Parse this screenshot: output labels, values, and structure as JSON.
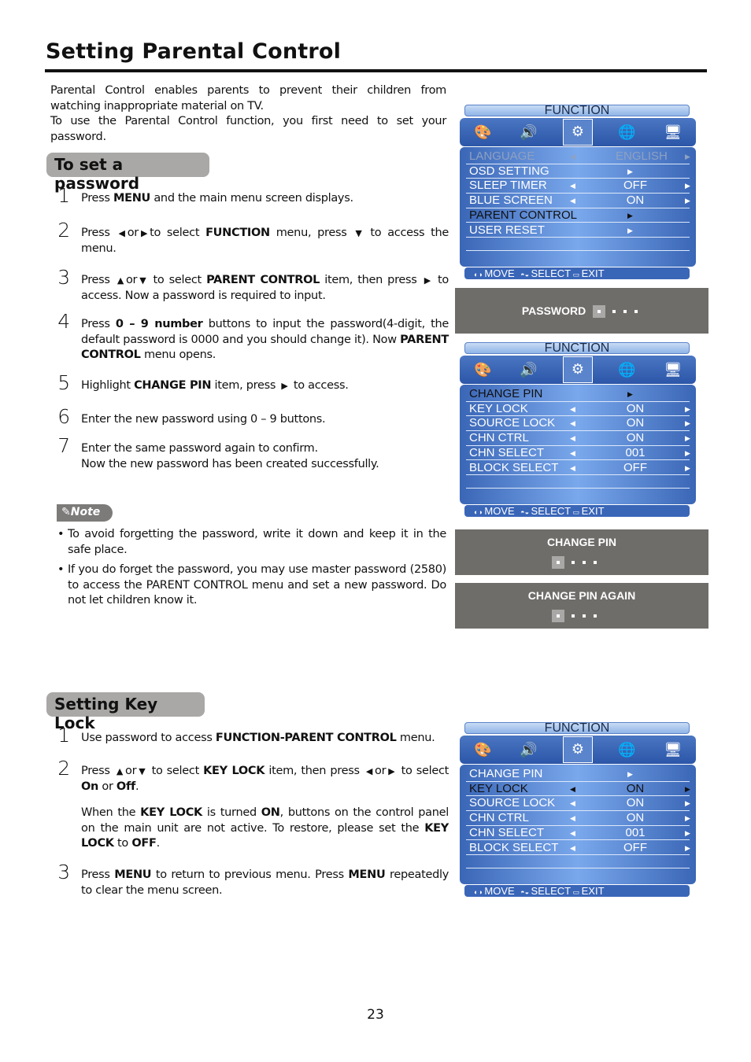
{
  "title": "Setting Parental Control",
  "intro": [
    [
      {
        "t": "Parental Control enables parents to prevent their children from watching inappropriate material on TV."
      }
    ],
    [
      {
        "t": "To use the Parental Control function, you first need to set your password."
      }
    ]
  ],
  "section1": {
    "heading": "To set a password",
    "steps": [
      {
        "n": "1",
        "text": [
          {
            "t": "Press "
          },
          {
            "t": "MENU",
            "b": 1
          },
          {
            "t": " and the main menu screen displays."
          }
        ]
      },
      {
        "n": "2",
        "text": [
          {
            "t": "Press "
          },
          {
            "i": "left-arrow"
          },
          {
            "t": "or"
          },
          {
            "i": "right-arrow"
          },
          {
            "t": "to select "
          },
          {
            "t": "FUNCTION",
            "b": 1
          },
          {
            "t": " menu,  press "
          },
          {
            "i": "down-arrow"
          },
          {
            "t": " to access the menu."
          }
        ]
      },
      {
        "n": "3",
        "text": [
          {
            "t": "Press "
          },
          {
            "i": "up-arrow"
          },
          {
            "t": "or"
          },
          {
            "i": "down-arrow"
          },
          {
            "t": " to select "
          },
          {
            "t": "PARENT CONTROL",
            "b": 1
          },
          {
            "t": " item, then press "
          },
          {
            "i": "right-arrow"
          },
          {
            "t": " to access. Now a password is required to input."
          }
        ]
      },
      {
        "n": "4",
        "text": [
          {
            "t": "Press "
          },
          {
            "t": "0 – 9 number",
            "b": 1
          },
          {
            "t": " buttons to input the password(4-digit, the default password is 0000 and you should change it). Now "
          },
          {
            "t": "PARENT CONTROL",
            "b": 1
          },
          {
            "t": " menu opens."
          }
        ]
      },
      {
        "n": "5",
        "text": [
          {
            "t": "Highlight "
          },
          {
            "t": "CHANGE PIN",
            "b": 1
          },
          {
            "t": " item, press "
          },
          {
            "i": "right-arrow"
          },
          {
            "t": " to access."
          }
        ]
      },
      {
        "n": "6",
        "text": [
          {
            "t": "Enter the new password using 0 – 9 buttons."
          }
        ]
      },
      {
        "n": "7",
        "text": [
          {
            "t": "Enter the same password again to confirm."
          },
          {
            "br": 1
          },
          {
            "t": "Now the new password has been created successfully."
          }
        ]
      }
    ]
  },
  "note": {
    "label": "Note",
    "icon": "paperclip-icon",
    "bullets": [
      [
        {
          "t": "To avoid forgetting the password, write it down and keep it in the safe place."
        }
      ],
      [
        {
          "t": "If you do forget the password, you may use master password (2580) to access the PARENT CONTROL menu and set a new password. Do not let children know it."
        }
      ]
    ]
  },
  "section2": {
    "heading": "Setting Key Lock",
    "steps": [
      {
        "n": "1",
        "text": [
          {
            "t": "Use password to access "
          },
          {
            "t": "FUNCTION-PARENT CONTROL",
            "b": 1
          },
          {
            "t": " menu."
          }
        ]
      },
      {
        "n": "2",
        "text": [
          {
            "t": "Press "
          },
          {
            "i": "up-arrow"
          },
          {
            "t": "or"
          },
          {
            "i": "down-arrow"
          },
          {
            "t": " to select "
          },
          {
            "t": "KEY LOCK",
            "b": 1
          },
          {
            "t": " item, then press "
          },
          {
            "i": "left-arrow"
          },
          {
            "t": "or"
          },
          {
            "i": "right-arrow"
          },
          {
            "t": " to select "
          },
          {
            "t": "On",
            "b": 1
          },
          {
            "t": " or "
          },
          {
            "t": "Off",
            "b": 1
          },
          {
            "t": "."
          }
        ]
      },
      {
        "n": "",
        "text": [
          {
            "t": "When the "
          },
          {
            "t": "KEY LOCK",
            "b": 1
          },
          {
            "t": " is turned "
          },
          {
            "t": "ON",
            "b": 1
          },
          {
            "t": ", buttons on the control panel on the main unit are not active. To restore, please set the "
          },
          {
            "t": "KEY LOCK",
            "b": 1
          },
          {
            "t": " to "
          },
          {
            "t": "OFF",
            "b": 1
          },
          {
            "t": "."
          }
        ]
      },
      {
        "n": "3",
        "text": [
          {
            "t": "Press "
          },
          {
            "t": "MENU",
            "b": 1
          },
          {
            "t": " to return to previous menu. Press "
          },
          {
            "t": "MENU",
            "b": 1
          },
          {
            "t": " repeatedly to clear the menu screen."
          }
        ]
      }
    ]
  },
  "menus": [
    {
      "title": "FUNCTION",
      "rows": [
        {
          "label": "LANGUAGE",
          "left": true,
          "value": "ENGLISH",
          "right": true,
          "state": "dim"
        },
        {
          "label": "OSD SETTING",
          "left": false,
          "value": "",
          "right": false,
          "mid": true,
          "state": "normal"
        },
        {
          "label": "SLEEP TIMER",
          "left": true,
          "value": "OFF",
          "right": true,
          "state": "normal"
        },
        {
          "label": "BLUE SCREEN",
          "left": true,
          "value": "ON",
          "right": true,
          "state": "normal"
        },
        {
          "label": "PARENT CONTROL",
          "left": false,
          "value": "",
          "right": false,
          "mid": true,
          "state": "selected"
        },
        {
          "label": "USER RESET",
          "left": false,
          "value": "",
          "right": false,
          "mid": true,
          "state": "normal"
        }
      ],
      "footer": {
        "move": "MOVE",
        "select": "SELECT",
        "exit": "EXIT"
      }
    },
    {
      "title": "FUNCTION",
      "rows": [
        {
          "label": "CHANGE  PIN",
          "mid": true,
          "state": "selected"
        },
        {
          "label": "KEY  LOCK",
          "left": true,
          "value": "ON",
          "right": true,
          "state": "normal"
        },
        {
          "label": "SOURCE  LOCK",
          "left": true,
          "value": "ON",
          "right": true,
          "state": "normal"
        },
        {
          "label": "CHN  CTRL",
          "left": true,
          "value": "ON",
          "right": true,
          "state": "normal"
        },
        {
          "label": "CHN  SELECT",
          "left": true,
          "value": "001",
          "right": true,
          "state": "normal"
        },
        {
          "label": "BLOCK  SELECT",
          "left": true,
          "value": "OFF",
          "right": true,
          "state": "normal"
        }
      ],
      "footer": {
        "move": "MOVE",
        "select": "SELECT",
        "exit": "EXIT"
      }
    },
    {
      "title": "FUNCTION",
      "rows": [
        {
          "label": "CHANGE  PIN",
          "mid": true,
          "state": "normal"
        },
        {
          "label": "KEY  LOCK",
          "left": true,
          "value": "ON",
          "right": true,
          "state": "selected"
        },
        {
          "label": "SOURCE  LOCK",
          "left": true,
          "value": "ON",
          "right": true,
          "state": "normal"
        },
        {
          "label": "CHN  CTRL",
          "left": true,
          "value": "ON",
          "right": true,
          "state": "normal"
        },
        {
          "label": "CHN  SELECT",
          "left": true,
          "value": "001",
          "right": true,
          "state": "normal"
        },
        {
          "label": "BLOCK  SELECT",
          "left": true,
          "value": "OFF",
          "right": true,
          "state": "normal"
        }
      ],
      "footer": {
        "move": "MOVE",
        "select": "SELECT",
        "exit": "EXIT"
      }
    }
  ],
  "menu_icons": [
    "palette-icon",
    "speaker-icon",
    "gear-wrench-icon",
    "globe-icon",
    "tv-screen-icon"
  ],
  "password_boxes": [
    {
      "label": "PASSWORD"
    },
    {
      "label": "CHANGE  PIN"
    },
    {
      "label": "CHANGE  PIN  AGAIN"
    }
  ],
  "page_number": "23",
  "colors": {
    "menu_blue": "#3a66b6",
    "osd_grey": "#6f6d6a",
    "heading_grey": "#a9a8a6"
  }
}
